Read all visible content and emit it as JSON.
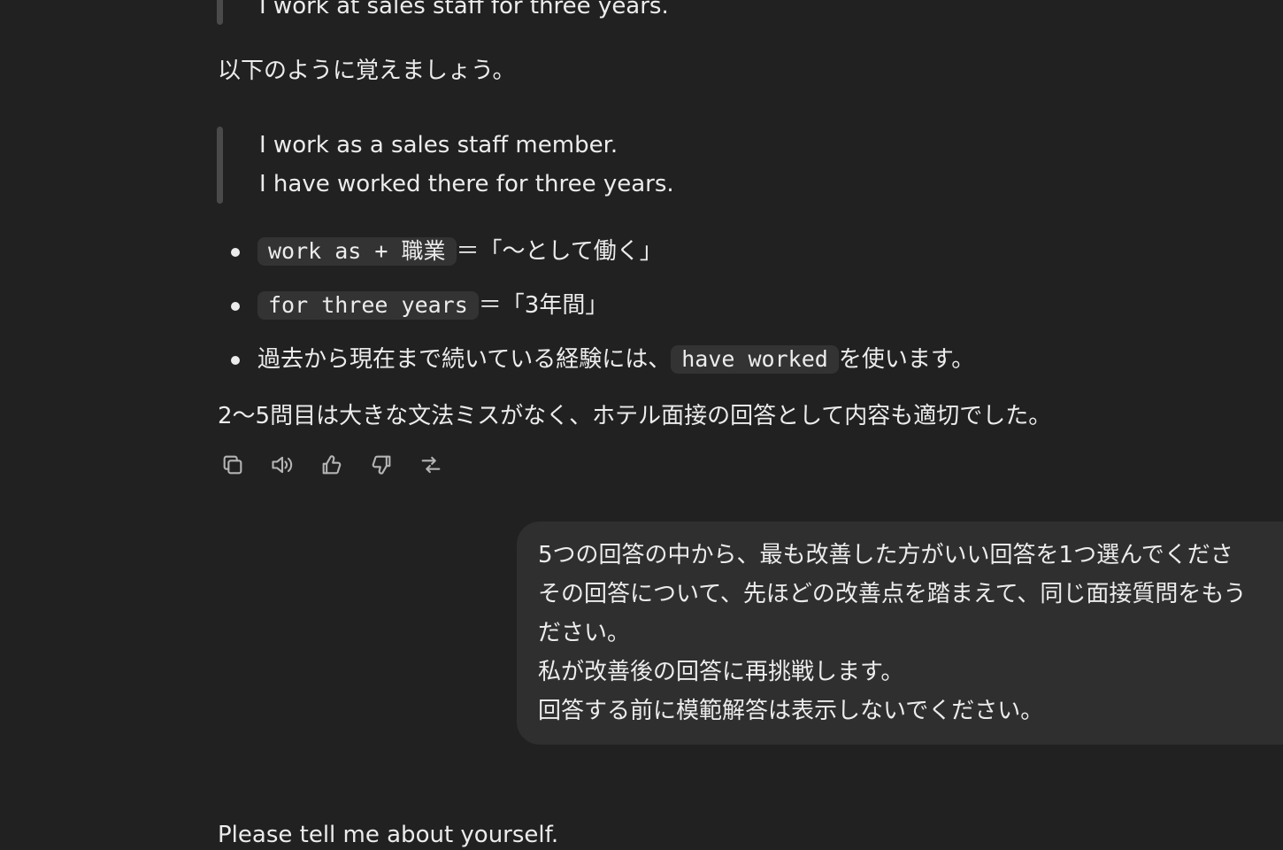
{
  "assistant": {
    "prev_quote_line": "I work at sales staff for three years.",
    "intro": "以下のように覚えましょう。",
    "quote_lines": [
      "I work as a sales staff member.",
      "I have worked there for three years."
    ],
    "bullets": [
      {
        "code": "work as + 職業",
        "text": "＝「〜として働く」"
      },
      {
        "code": "for three years",
        "text": "＝「3年間」"
      },
      {
        "before": "過去から現在まで続いている経験には、",
        "code": "have worked",
        "after": "を使います。"
      }
    ],
    "conclusion": "2〜5問目は大きな文法ミスがなく、ホテル面接の回答として内容も適切でした。",
    "actions": [
      "copy-icon",
      "speaker-icon",
      "thumbs-up-icon",
      "thumbs-down-icon",
      "share-icon"
    ]
  },
  "user_message": {
    "lines": [
      "5つの回答の中から、最も改善した方がいい回答を1つ選んでくださ",
      "その回答について、先ほどの改善点を踏まえて、同じ面接質問をもう",
      "ださい。",
      "私が改善後の回答に再挑戦します。",
      "回答する前に模範解答は表示しないでください。"
    ]
  },
  "next_assistant": {
    "first_line": "Please tell me about yourself."
  }
}
